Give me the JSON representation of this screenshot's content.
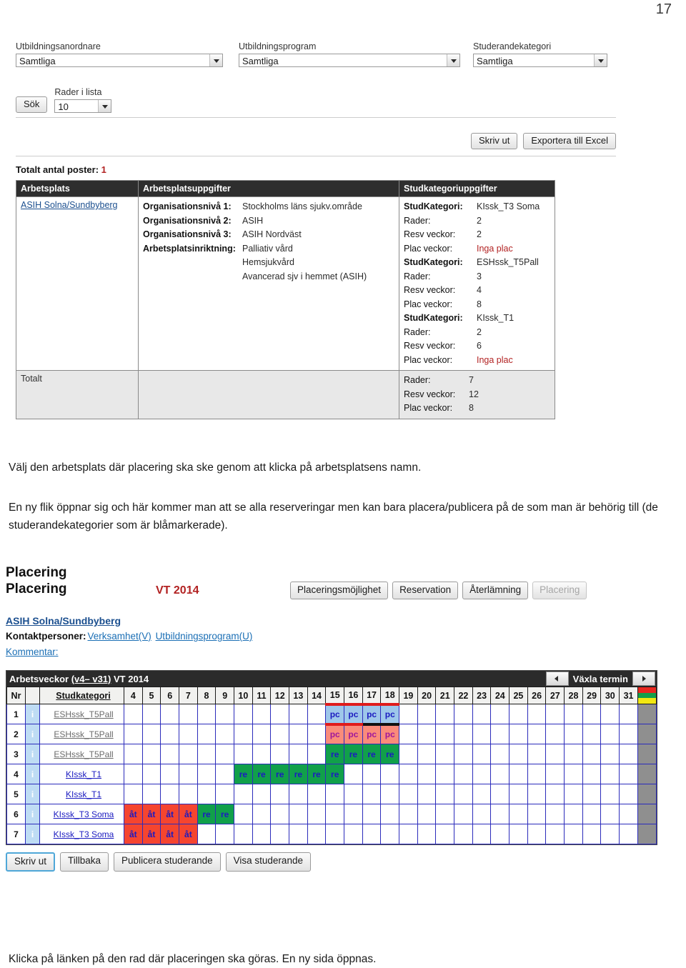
{
  "page": {
    "number": "17"
  },
  "search_panel": {
    "filters": [
      {
        "label": "Utbildningsanordnare",
        "value": "Samtliga"
      },
      {
        "label": "Utbildningsprogram",
        "value": "Samtliga"
      },
      {
        "label": "Studerandekategori",
        "value": "Samtliga"
      }
    ],
    "search_button": "Sök",
    "rows_label": "Rader i lista",
    "rows_value": "10",
    "print_button": "Skriv ut",
    "export_button": "Exportera till Excel"
  },
  "results": {
    "total_label": "Totalt antal poster:",
    "total_count": "1",
    "columns": [
      "Arbetsplats",
      "Arbetsplatsuppgifter",
      "Studkategoriuppgifter"
    ],
    "workplace_link": "ASIH Solna/Sundbyberg",
    "workplace_details": [
      {
        "key": "Organisationsnivå 1:",
        "value": "Stockholms läns sjukv.område"
      },
      {
        "key": "Organisationsnivå 2:",
        "value": "ASIH"
      },
      {
        "key": "Organisationsnivå 3:",
        "value": "ASIH Nordväst"
      },
      {
        "key": "Arbetsplatsinriktning:",
        "value": "Palliativ vård"
      },
      {
        "key": "",
        "value": "Hemsjukvård"
      },
      {
        "key": "",
        "value": "Avancerad sjv i hemmet (ASIH)"
      }
    ],
    "category_details": [
      {
        "key": "StudKategori:",
        "value": "KIssk_T3 Soma",
        "bold": true
      },
      {
        "key": "Rader:",
        "value": "2"
      },
      {
        "key": "Resv veckor:",
        "value": "2"
      },
      {
        "key": "Plac veckor:",
        "value": "Inga plac",
        "red": true
      },
      {
        "key": "StudKategori:",
        "value": "ESHssk_T5Pall",
        "bold": true
      },
      {
        "key": "Rader:",
        "value": "3"
      },
      {
        "key": "Resv veckor:",
        "value": "4"
      },
      {
        "key": "Plac veckor:",
        "value": "8"
      },
      {
        "key": "StudKategori:",
        "value": "KIssk_T1",
        "bold": true
      },
      {
        "key": "Rader:",
        "value": "2"
      },
      {
        "key": "Resv veckor:",
        "value": "6"
      },
      {
        "key": "Plac veckor:",
        "value": "Inga plac",
        "red": true
      }
    ],
    "total_row_label": "Totalt",
    "total_row_values": [
      {
        "key": "Rader:",
        "value": "7"
      },
      {
        "key": "Resv veckor:",
        "value": "12"
      },
      {
        "key": "Plac veckor:",
        "value": "8"
      }
    ]
  },
  "copy": {
    "p1": "Välj den arbetsplats där placering ska ske genom att klicka på arbetsplatsens namn.",
    "p2": "En ny flik öppnar sig och här kommer man att se alla reserveringar men kan bara placera/publicera på de som man är behörig till (de studerandekategorier som är blåmarkerade).",
    "p3": "Klicka på länken på den rad där placeringen ska göras. En ny sida öppnas."
  },
  "placering": {
    "heading": "Placering",
    "subheading": "Placering",
    "term": "VT 2014",
    "tabs": [
      {
        "label": "Placeringsmöjlighet",
        "disabled": false
      },
      {
        "label": "Reservation",
        "disabled": false
      },
      {
        "label": "Återlämning",
        "disabled": false
      },
      {
        "label": "Placering",
        "disabled": true
      }
    ],
    "workplace_link": "ASIH Solna/Sundbyberg",
    "contacts_label": "Kontaktpersoner:",
    "contact_links": [
      "Verksamhet(V)",
      "Utbildningsprogram(U)"
    ],
    "comment_label": "Kommentar:",
    "grid_title_pre": "Arbetsveckor ",
    "grid_title_weeks": "(v4– v31)",
    "grid_title_post": " VT 2014",
    "term_nav_label": "Växla termin",
    "grid_columns": {
      "nr": "Nr",
      "info": "i",
      "category": "Studkategori"
    },
    "weeks": [
      4,
      5,
      6,
      7,
      8,
      9,
      10,
      11,
      12,
      13,
      14,
      15,
      16,
      17,
      18,
      19,
      20,
      21,
      22,
      23,
      24,
      25,
      26,
      27,
      28,
      29,
      30,
      31
    ],
    "legend_colors": [
      "#e8271f",
      "#12a04a",
      "#f2e711"
    ],
    "rows": [
      {
        "nr": "1",
        "category": "ESHssk_T5Pall",
        "muted": true,
        "cells": [
          {
            "week": 15,
            "text": "pc",
            "type": "pc-blue"
          },
          {
            "week": 16,
            "text": "pc",
            "type": "pc-blue"
          },
          {
            "week": 17,
            "text": "pc",
            "type": "pc-blue"
          },
          {
            "week": 18,
            "text": "pc",
            "type": "pc-blue"
          }
        ]
      },
      {
        "nr": "2",
        "category": "ESHssk_T5Pall",
        "muted": true,
        "cells": [
          {
            "week": 15,
            "text": "pc",
            "type": "pc-red"
          },
          {
            "week": 16,
            "text": "pc",
            "type": "pc-red"
          },
          {
            "week": 17,
            "text": "pc",
            "type": "pc-red blktop"
          },
          {
            "week": 18,
            "text": "pc",
            "type": "pc-red blktop"
          }
        ]
      },
      {
        "nr": "3",
        "category": "ESHssk_T5Pall",
        "muted": true,
        "cells": [
          {
            "week": 15,
            "text": "re",
            "type": "re"
          },
          {
            "week": 16,
            "text": "re",
            "type": "re"
          },
          {
            "week": 17,
            "text": "re",
            "type": "re"
          },
          {
            "week": 18,
            "text": "re",
            "type": "re"
          }
        ]
      },
      {
        "nr": "4",
        "category": "KIssk_T1",
        "muted": false,
        "cells": [
          {
            "week": 10,
            "text": "re",
            "type": "re"
          },
          {
            "week": 11,
            "text": "re",
            "type": "re"
          },
          {
            "week": 12,
            "text": "re",
            "type": "re"
          },
          {
            "week": 13,
            "text": "re",
            "type": "re"
          },
          {
            "week": 14,
            "text": "re",
            "type": "re"
          },
          {
            "week": 15,
            "text": "re",
            "type": "re"
          }
        ]
      },
      {
        "nr": "5",
        "category": "KIssk_T1",
        "muted": false,
        "cells": []
      },
      {
        "nr": "6",
        "category": "KIssk_T3 Soma",
        "muted": false,
        "cells": [
          {
            "week": 4,
            "text": "åt",
            "type": "at"
          },
          {
            "week": 5,
            "text": "åt",
            "type": "at"
          },
          {
            "week": 6,
            "text": "åt",
            "type": "at"
          },
          {
            "week": 7,
            "text": "åt",
            "type": "at"
          },
          {
            "week": 8,
            "text": "re",
            "type": "re"
          },
          {
            "week": 9,
            "text": "re",
            "type": "re"
          }
        ]
      },
      {
        "nr": "7",
        "category": "KIssk_T3 Soma",
        "muted": false,
        "cells": [
          {
            "week": 4,
            "text": "åt",
            "type": "at"
          },
          {
            "week": 5,
            "text": "åt",
            "type": "at"
          },
          {
            "week": 6,
            "text": "åt",
            "type": "at"
          },
          {
            "week": 7,
            "text": "åt",
            "type": "at"
          }
        ]
      }
    ],
    "footer_buttons": [
      {
        "label": "Skriv ut",
        "focus": true
      },
      {
        "label": "Tillbaka",
        "focus": false
      },
      {
        "label": "Publicera studerande",
        "focus": false
      },
      {
        "label": "Visa studerande",
        "focus": false
      }
    ]
  }
}
